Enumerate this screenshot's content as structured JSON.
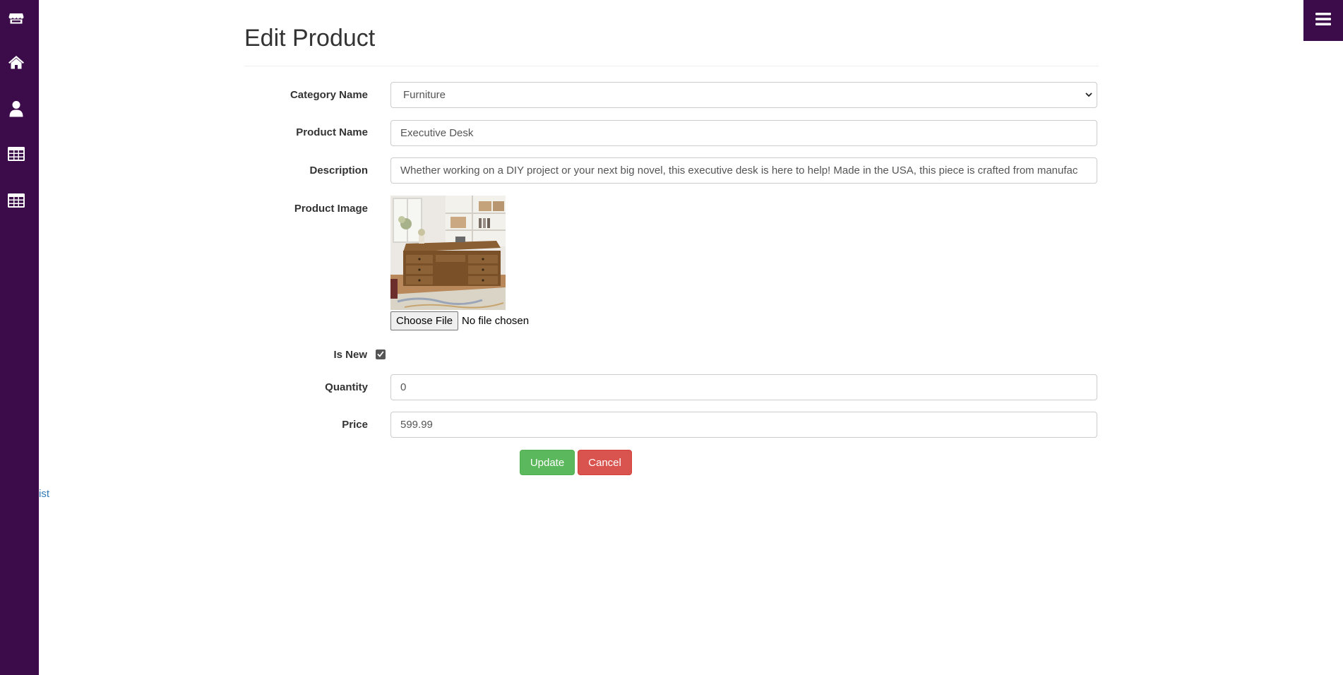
{
  "sidebar": {
    "icons": [
      "store-icon",
      "home-icon",
      "user-icon",
      "table-icon",
      "table-icon"
    ],
    "bg_color": "#3b0b4a"
  },
  "menu_button": {
    "icon": "hamburger-menu-icon"
  },
  "stray_link": "ist",
  "page": {
    "title": "Edit Product"
  },
  "form": {
    "category": {
      "label": "Category Name",
      "value": "Furniture"
    },
    "product_name": {
      "label": "Product Name",
      "value": "Executive Desk"
    },
    "description": {
      "label": "Description",
      "value": "Whether working on a DIY project or your next big novel, this executive desk is here to help! Made in the USA, this piece is crafted from manufac"
    },
    "product_image": {
      "label": "Product Image",
      "choose_file": "Choose File",
      "no_file": "No file chosen"
    },
    "is_new": {
      "label": "Is New",
      "checked": true
    },
    "quantity": {
      "label": "Quantity",
      "value": "0"
    },
    "price": {
      "label": "Price",
      "value": "599.99"
    },
    "update_label": "Update",
    "cancel_label": "Cancel"
  },
  "colors": {
    "update": "#5cb85c",
    "cancel": "#d9534f",
    "link": "#337ab7"
  }
}
